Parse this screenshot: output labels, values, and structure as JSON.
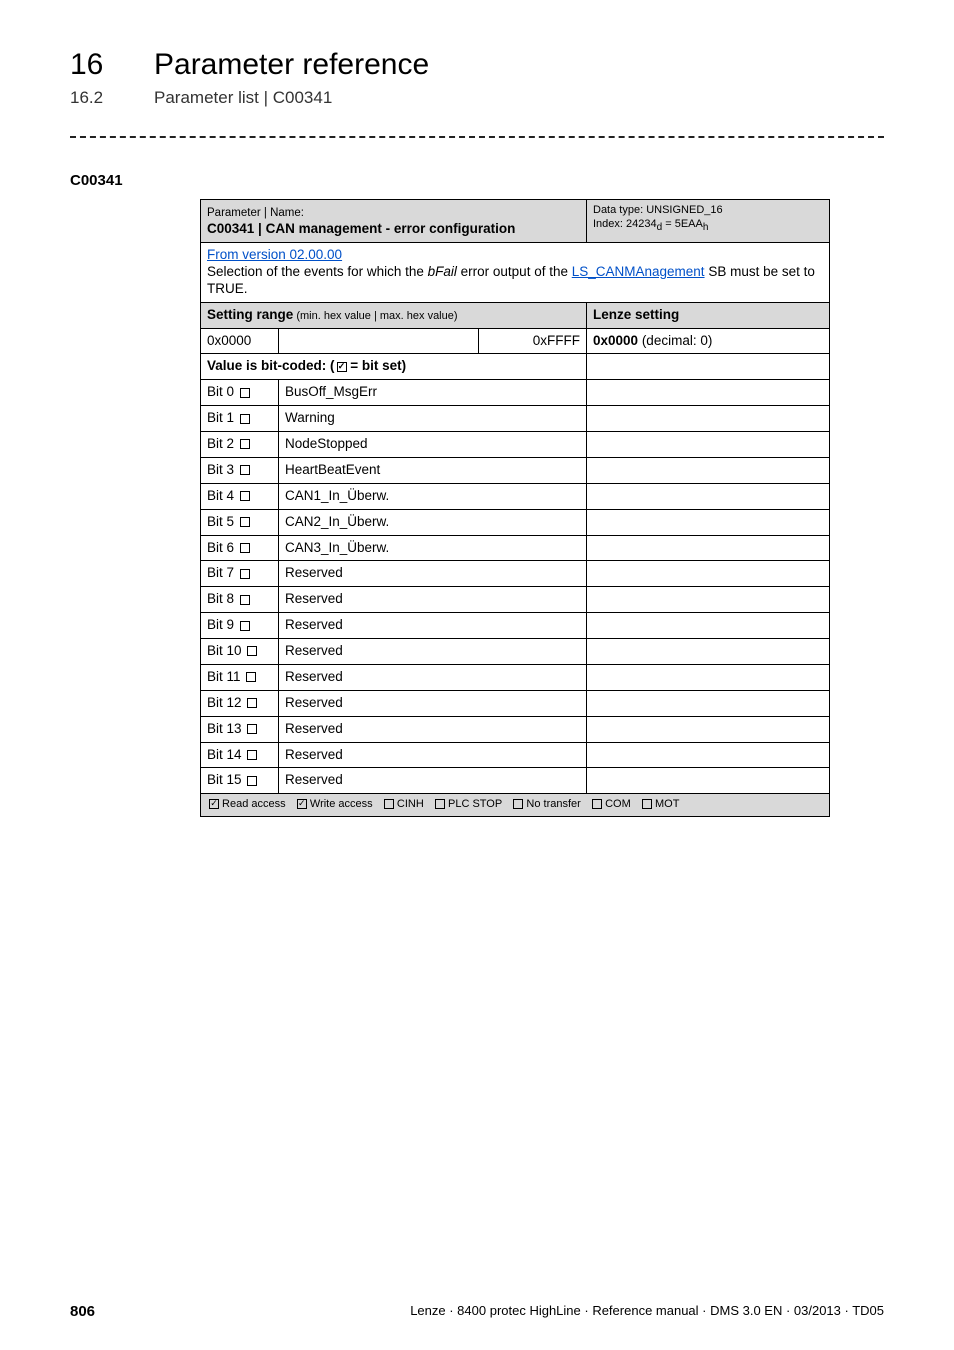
{
  "header": {
    "chapter_no": "16",
    "chapter_title": "Parameter reference",
    "section_no": "16.2",
    "section_title": "Parameter list | C00341"
  },
  "anchor": "C00341",
  "param": {
    "label": "Parameter | Name:",
    "code_name": "C00341 | CAN management - error configuration",
    "dtype_line1": "Data type: UNSIGNED_16",
    "dtype_line2_pre": "Index: 24234",
    "dtype_line2_sub1": "d",
    "dtype_line2_mid": " = 5EAA",
    "dtype_line2_sub2": "h",
    "version": "From version 02.00.00",
    "desc_pre": "Selection of the events for which the ",
    "desc_ital": "bFail",
    "desc_mid": " error output of the ",
    "desc_link": "LS_CANMAnagement",
    "desc_post": " SB must be set to TRUE.",
    "setting_label": "Setting range",
    "setting_suffix": " (min. hex value | max. hex value)",
    "lenze_label": "Lenze setting",
    "range_min": "0x0000",
    "range_max": "0xFFFF",
    "default_bold": "0x0000",
    "default_paren": "  (decimal: 0)",
    "bitset_label_pre": "Value is bit-coded:  (",
    "bitset_label_post": " = bit set)",
    "bits": [
      {
        "idx": "Bit 0",
        "name": "BusOff_MsgErr"
      },
      {
        "idx": "Bit 1",
        "name": "Warning"
      },
      {
        "idx": "Bit 2",
        "name": "NodeStopped"
      },
      {
        "idx": "Bit 3",
        "name": "HeartBeatEvent"
      },
      {
        "idx": "Bit 4",
        "name": "CAN1_In_Überw."
      },
      {
        "idx": "Bit 5",
        "name": "CAN2_In_Überw."
      },
      {
        "idx": "Bit 6",
        "name": "CAN3_In_Überw."
      },
      {
        "idx": "Bit 7",
        "name": "Reserved"
      },
      {
        "idx": "Bit 8",
        "name": "Reserved"
      },
      {
        "idx": "Bit 9",
        "name": "Reserved"
      },
      {
        "idx": "Bit 10",
        "name": "Reserved"
      },
      {
        "idx": "Bit 11",
        "name": "Reserved"
      },
      {
        "idx": "Bit 12",
        "name": "Reserved"
      },
      {
        "idx": "Bit 13",
        "name": "Reserved"
      },
      {
        "idx": "Bit 14",
        "name": "Reserved"
      },
      {
        "idx": "Bit 15",
        "name": "Reserved"
      }
    ],
    "rw": {
      "read": {
        "checked": true,
        "label": " Read access"
      },
      "write": {
        "checked": true,
        "label": " Write access"
      },
      "cinh": {
        "checked": false,
        "label": " CINH"
      },
      "plc": {
        "checked": false,
        "label": " PLC STOP"
      },
      "noxfr": {
        "checked": false,
        "label": " No transfer"
      },
      "com": {
        "checked": false,
        "label": " COM"
      },
      "mot": {
        "checked": false,
        "label": " MOT"
      }
    }
  },
  "footer": {
    "page_no": "806",
    "doc": "Lenze · 8400 protec HighLine · Reference manual · DMS 3.0 EN · 03/2013 · TD05"
  }
}
